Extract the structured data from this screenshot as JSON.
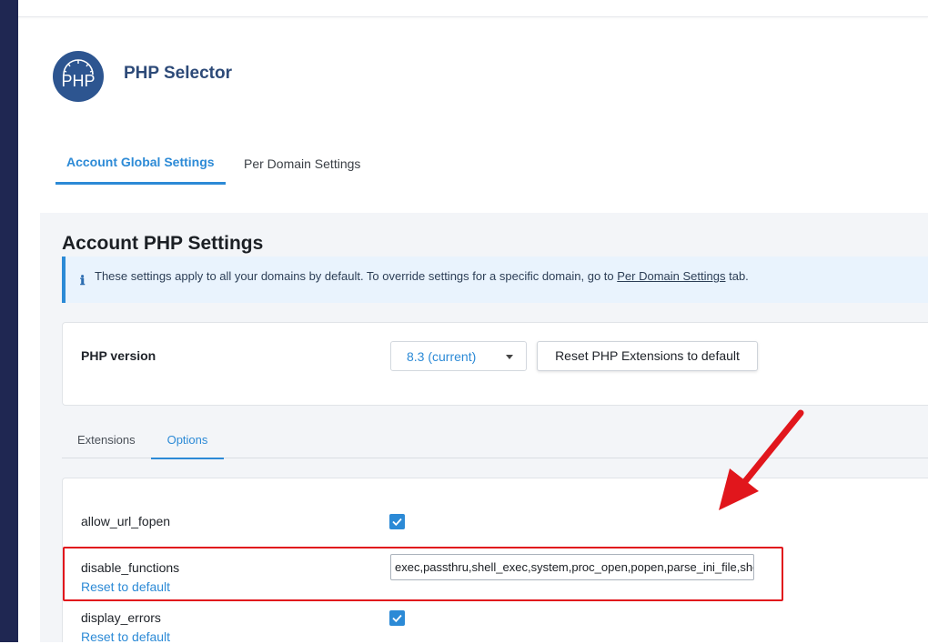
{
  "header": {
    "title": "PHP Selector",
    "logo_text": "PHP"
  },
  "tabs": [
    {
      "label": "Account Global Settings",
      "active": true
    },
    {
      "label": "Per Domain Settings",
      "active": false
    }
  ],
  "section": {
    "title": "Account PHP Settings",
    "info": {
      "text_before": "These settings apply to all your domains by default. To override settings for a specific domain, go to",
      "link": "Per Domain Settings",
      "text_after": "tab."
    }
  },
  "php_version": {
    "label": "PHP version",
    "selected": "8.3 (current)",
    "reset_button": "Reset PHP Extensions to default"
  },
  "subtabs": [
    {
      "label": "Extensions",
      "active": false
    },
    {
      "label": "Options",
      "active": true
    }
  ],
  "options": [
    {
      "name": "allow_url_fopen",
      "checked": true
    },
    {
      "name": "disable_functions",
      "value": "exec,passthru,shell_exec,system,proc_open,popen,parse_ini_file,show_source",
      "reset": "Reset to default"
    },
    {
      "name": "display_errors",
      "checked": true,
      "reset": "Reset to default"
    }
  ],
  "colors": {
    "accent": "#2c8ad6",
    "highlight": "#e1161c",
    "sidebar": "#1f2752",
    "logo": "#2d5590"
  }
}
